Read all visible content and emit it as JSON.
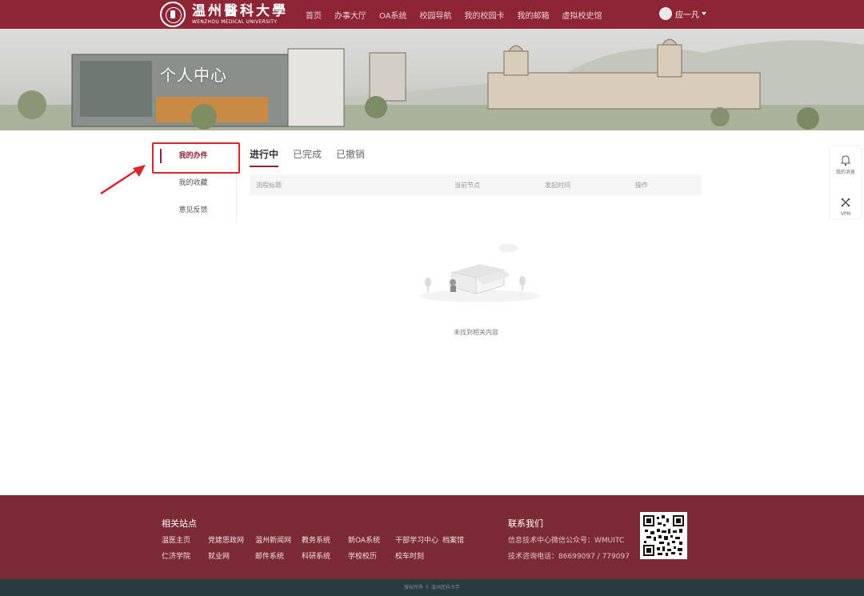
{
  "header": {
    "logo_cn": "温州醫科大學",
    "logo_en": "WENZHOU MEDICAL UNIVERSITY",
    "nav": [
      "首页",
      "办事大厅",
      "OA系统",
      "校园导航",
      "我的校园卡",
      "我的邮箱",
      "虚拟校史馆"
    ],
    "user_name": "应一凡"
  },
  "banner": {
    "title": "个人中心"
  },
  "sidebar": {
    "items": [
      "我的办件",
      "我的收藏",
      "意见反馈"
    ],
    "active": "我的办件"
  },
  "tabs": {
    "items": [
      "进行中",
      "已完成",
      "已撤销"
    ],
    "active": "进行中"
  },
  "table": {
    "columns": [
      "流程标题",
      "当前节点",
      "发起时间",
      "操作"
    ]
  },
  "empty_state": {
    "text": "未找到相关内容"
  },
  "float_bar": {
    "items": [
      {
        "icon": "bell-icon",
        "label": "我的消息"
      },
      {
        "icon": "vpn-icon",
        "label": "VPN"
      }
    ]
  },
  "footer": {
    "related_title": "相关站点",
    "links": [
      "温医主页",
      "党建思政网",
      "温州新闻网",
      "教务系统",
      "新OA系统",
      "干部学习中心",
      "档案馆",
      "仁济学院",
      "就业网",
      "邮件系统",
      "科研系统",
      "学校校历",
      "校车时刻"
    ],
    "contact_title": "联系我们",
    "wechat": "信息技术中心微信公众号：WMUITC",
    "phone": "技术咨询电话：86699097 / 779097"
  },
  "copyright": "版权所有 © 温州医科大学",
  "colors": {
    "brand": "#8d2537",
    "footer": "#7c2a35",
    "bottom_bar": "#283c40",
    "highlight": "#d9262b"
  }
}
